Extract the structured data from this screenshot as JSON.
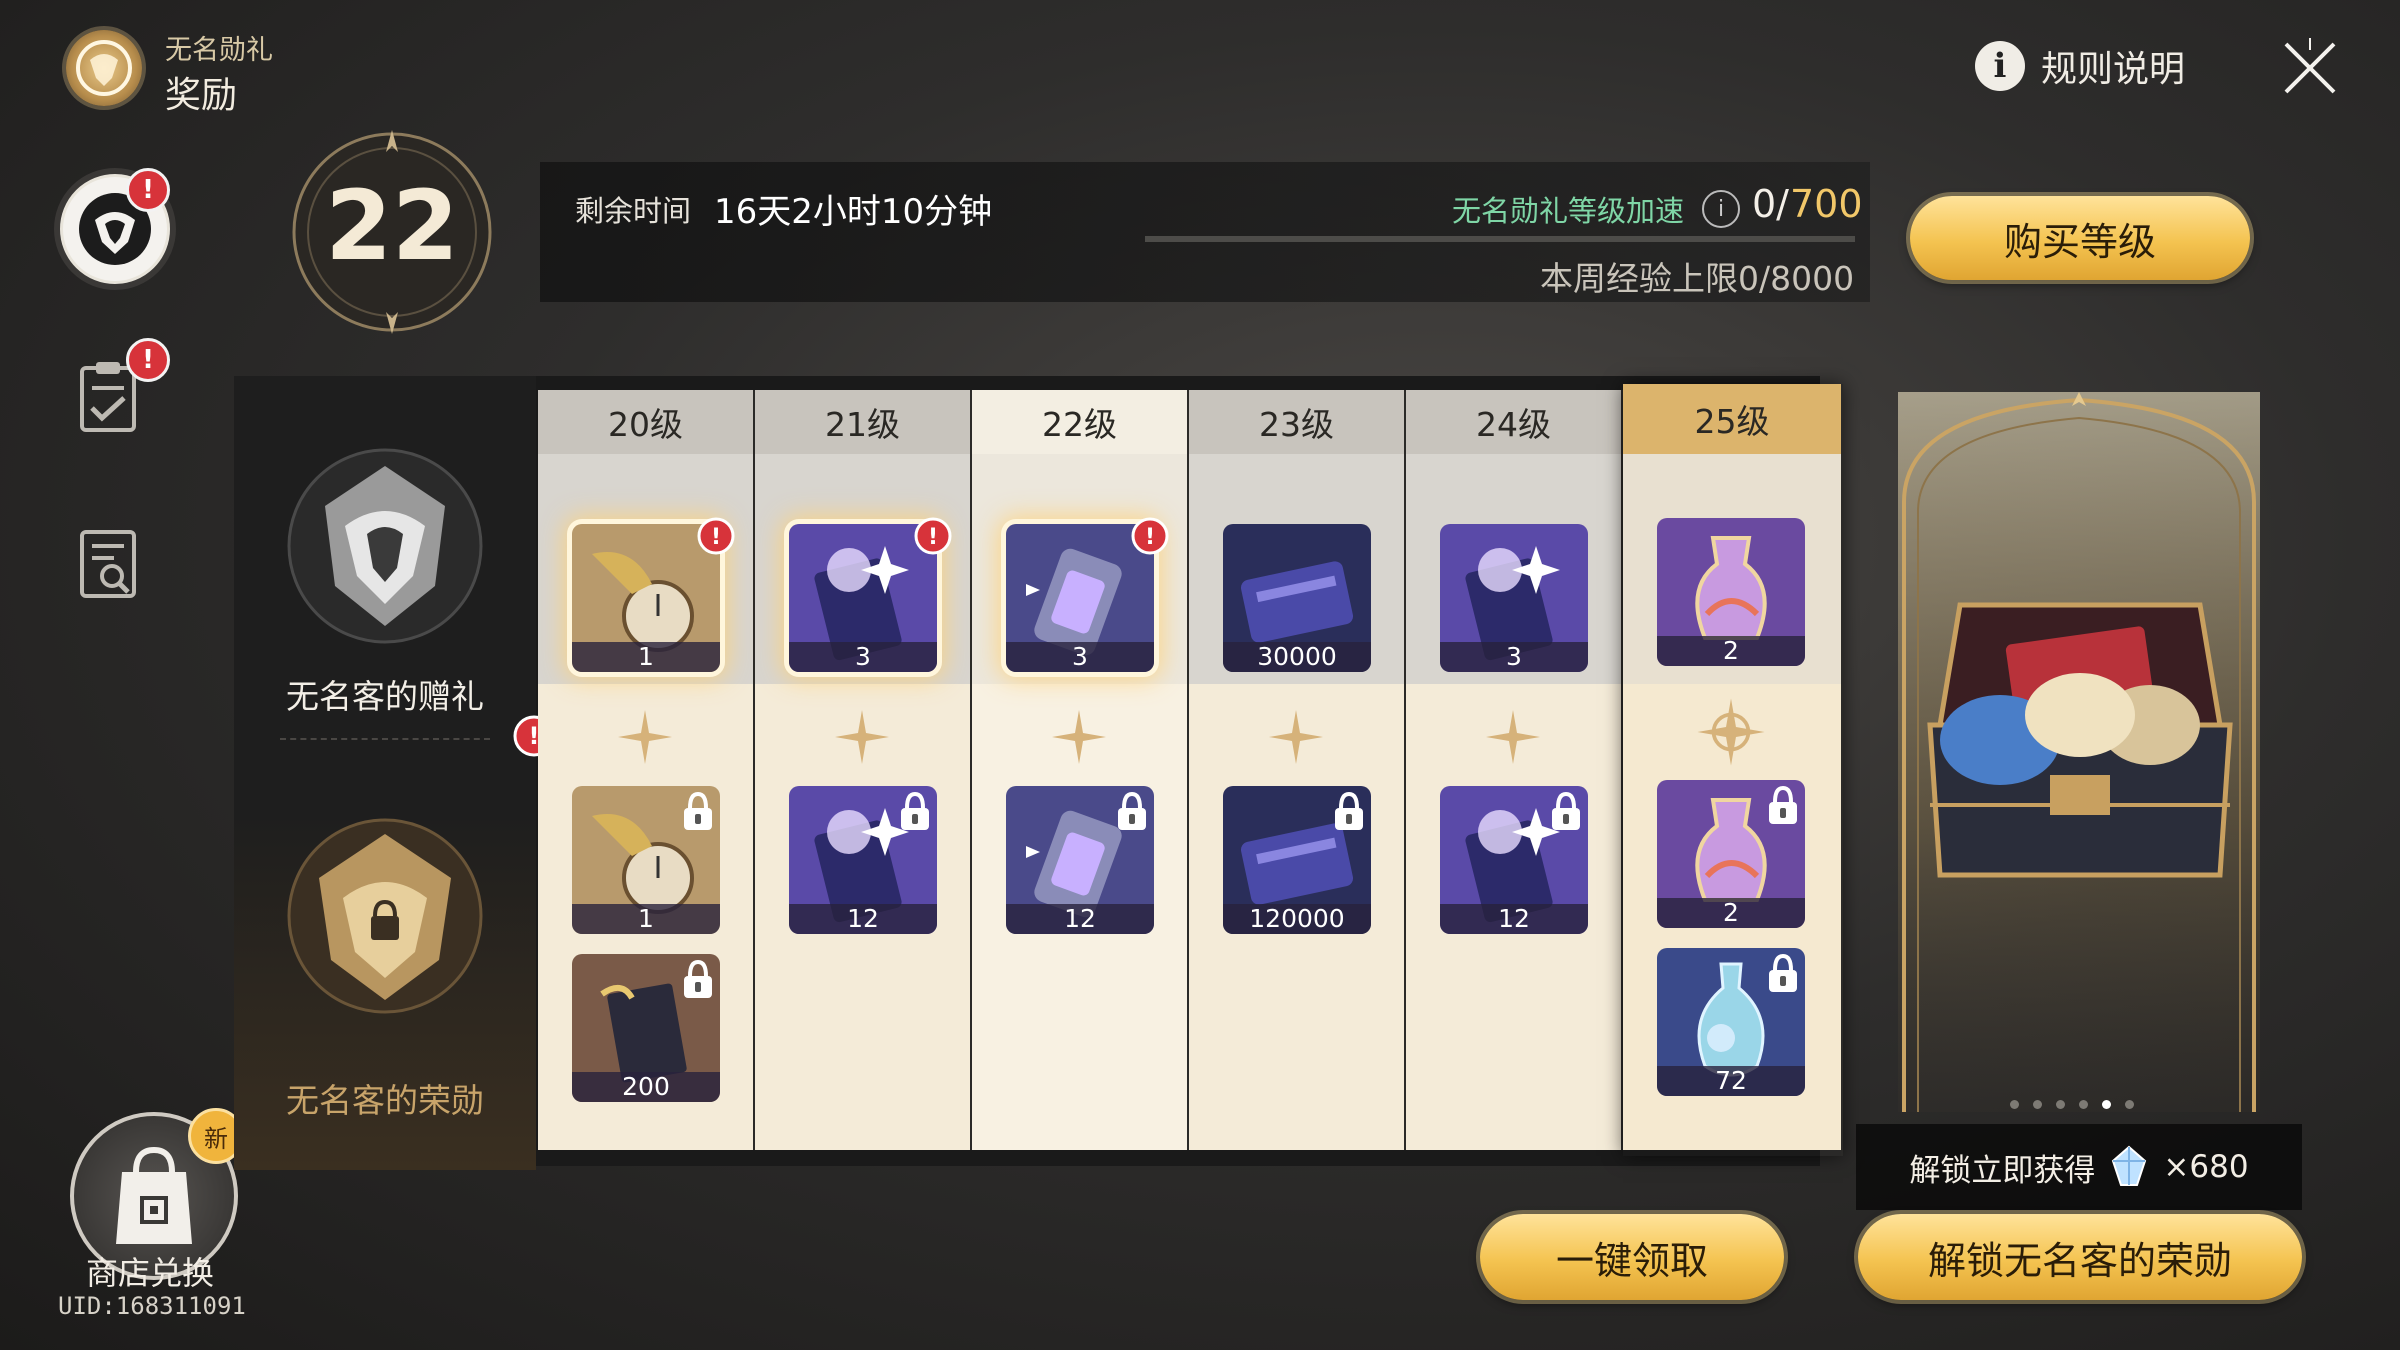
{
  "header": {
    "subtitle": "无名勋礼",
    "title": "奖励",
    "rules_label": "规则说明",
    "info_glyph": "i",
    "close_icon": "close-x-icon"
  },
  "nav": {
    "badge_glyph": "!",
    "items": [
      "pass-emblem-icon",
      "mission-clipboard-icon",
      "records-search-icon"
    ]
  },
  "shop": {
    "label": "商店兑换",
    "new_badge": "新",
    "uid": "UID:168311091"
  },
  "level": {
    "current": "22",
    "remaining_label": "剩余时间",
    "remaining_value": "16天2小时10分钟",
    "accel_label": "无名勋礼等级加速",
    "exp_current": "0/",
    "exp_max": "700",
    "exp_progress": 0,
    "weekly_cap": "本周经验上限0/8000",
    "buy_button": "购买等级"
  },
  "tiers": {
    "free_name": "无名客的赠礼",
    "paid_name": "无名客的荣勋"
  },
  "columns": [
    {
      "level": "20级",
      "free": {
        "qty": "1",
        "glow": true,
        "alert": true,
        "art": "pocket-watch"
      },
      "paid": [
        {
          "qty": "1",
          "art": "pocket-watch"
        },
        {
          "qty": "200",
          "art": "book"
        }
      ]
    },
    {
      "level": "21级",
      "free": {
        "qty": "3",
        "glow": true,
        "alert": true,
        "art": "ticket-star"
      },
      "paid": [
        {
          "qty": "12",
          "art": "ticket-star"
        }
      ]
    },
    {
      "level": "22级",
      "current": true,
      "free": {
        "qty": "3",
        "glow": true,
        "alert": true,
        "art": "film-canister"
      },
      "paid": [
        {
          "qty": "12",
          "art": "film-canister"
        }
      ]
    },
    {
      "level": "23级",
      "free": {
        "qty": "30000",
        "art": "credit-card"
      },
      "paid": [
        {
          "qty": "120000",
          "art": "credit-card"
        }
      ]
    },
    {
      "level": "24级",
      "free": {
        "qty": "3",
        "art": "ticket-star"
      },
      "paid": [
        {
          "qty": "12",
          "art": "ticket-star"
        }
      ]
    },
    {
      "level": "25级",
      "next": true,
      "free": {
        "qty": "2",
        "art": "potion"
      },
      "paid": [
        {
          "qty": "2",
          "art": "potion"
        },
        {
          "qty": "72",
          "art": "crystal-flask"
        }
      ]
    }
  ],
  "preview": {
    "dot_count": 6,
    "active_dot": 4,
    "unlock_tip_label": "解锁立即获得",
    "unlock_tip_qty": "×680",
    "unlock_button": "解锁无名客的荣勋"
  },
  "claim_all_button": "一键领取",
  "colors": {
    "gold": "#f4c350",
    "accent_green": "#7fd6a6",
    "alert_red": "#d7333a"
  }
}
